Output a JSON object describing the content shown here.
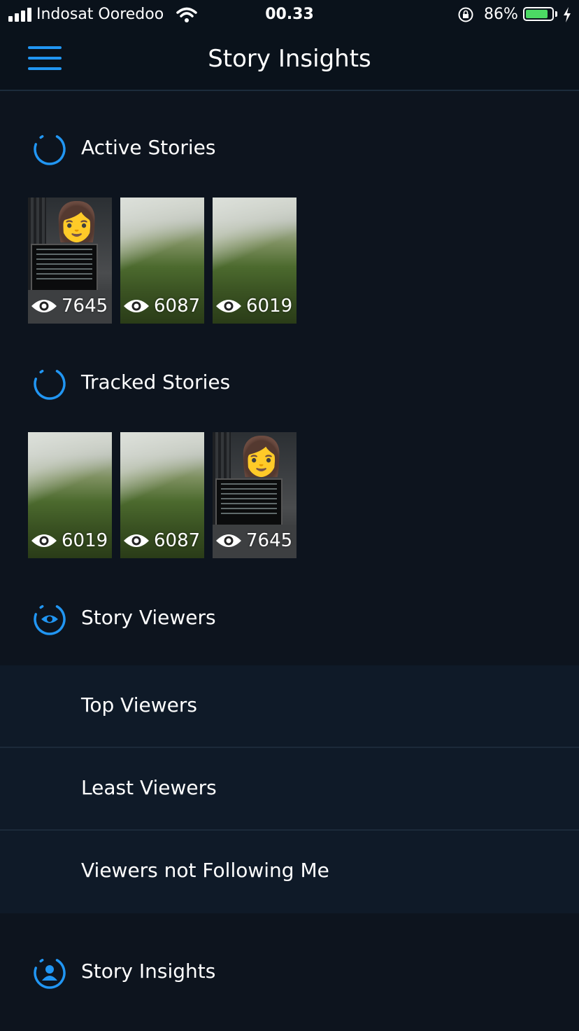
{
  "status_bar": {
    "carrier": "Indosat Ooredoo",
    "time": "00.33",
    "battery_percent": "86%",
    "battery_level": 0.86,
    "icons": [
      "signal-icon",
      "wifi-icon",
      "rotation-lock-icon",
      "battery-icon",
      "charging-bolt-icon"
    ]
  },
  "nav": {
    "title": "Story Insights",
    "menu_icon": "hamburger-menu-icon"
  },
  "colors": {
    "accent": "#2196f3",
    "background": "#0d141e",
    "list_background": "#0f1a28",
    "battery": "#4cd964"
  },
  "active_stories": {
    "title": "Active Stories",
    "icon": "loading-ring-icon",
    "items": [
      {
        "thumbnail": "desk-selfie",
        "views": "7645"
      },
      {
        "thumbnail": "foggy-hill",
        "views": "6087"
      },
      {
        "thumbnail": "foggy-hill-hiker",
        "views": "6019"
      }
    ]
  },
  "tracked_stories": {
    "title": "Tracked Stories",
    "icon": "loading-ring-icon",
    "items": [
      {
        "thumbnail": "foggy-hill-hiker",
        "views": "6019"
      },
      {
        "thumbnail": "foggy-hill",
        "views": "6087"
      },
      {
        "thumbnail": "desk-selfie",
        "views": "7645"
      }
    ]
  },
  "story_viewers": {
    "title": "Story Viewers",
    "icon": "eye-ring-icon",
    "items": [
      {
        "label": "Top Viewers"
      },
      {
        "label": "Least Viewers"
      },
      {
        "label": "Viewers not Following Me"
      }
    ]
  },
  "story_insights": {
    "title": "Story Insights",
    "icon": "user-ring-icon"
  }
}
